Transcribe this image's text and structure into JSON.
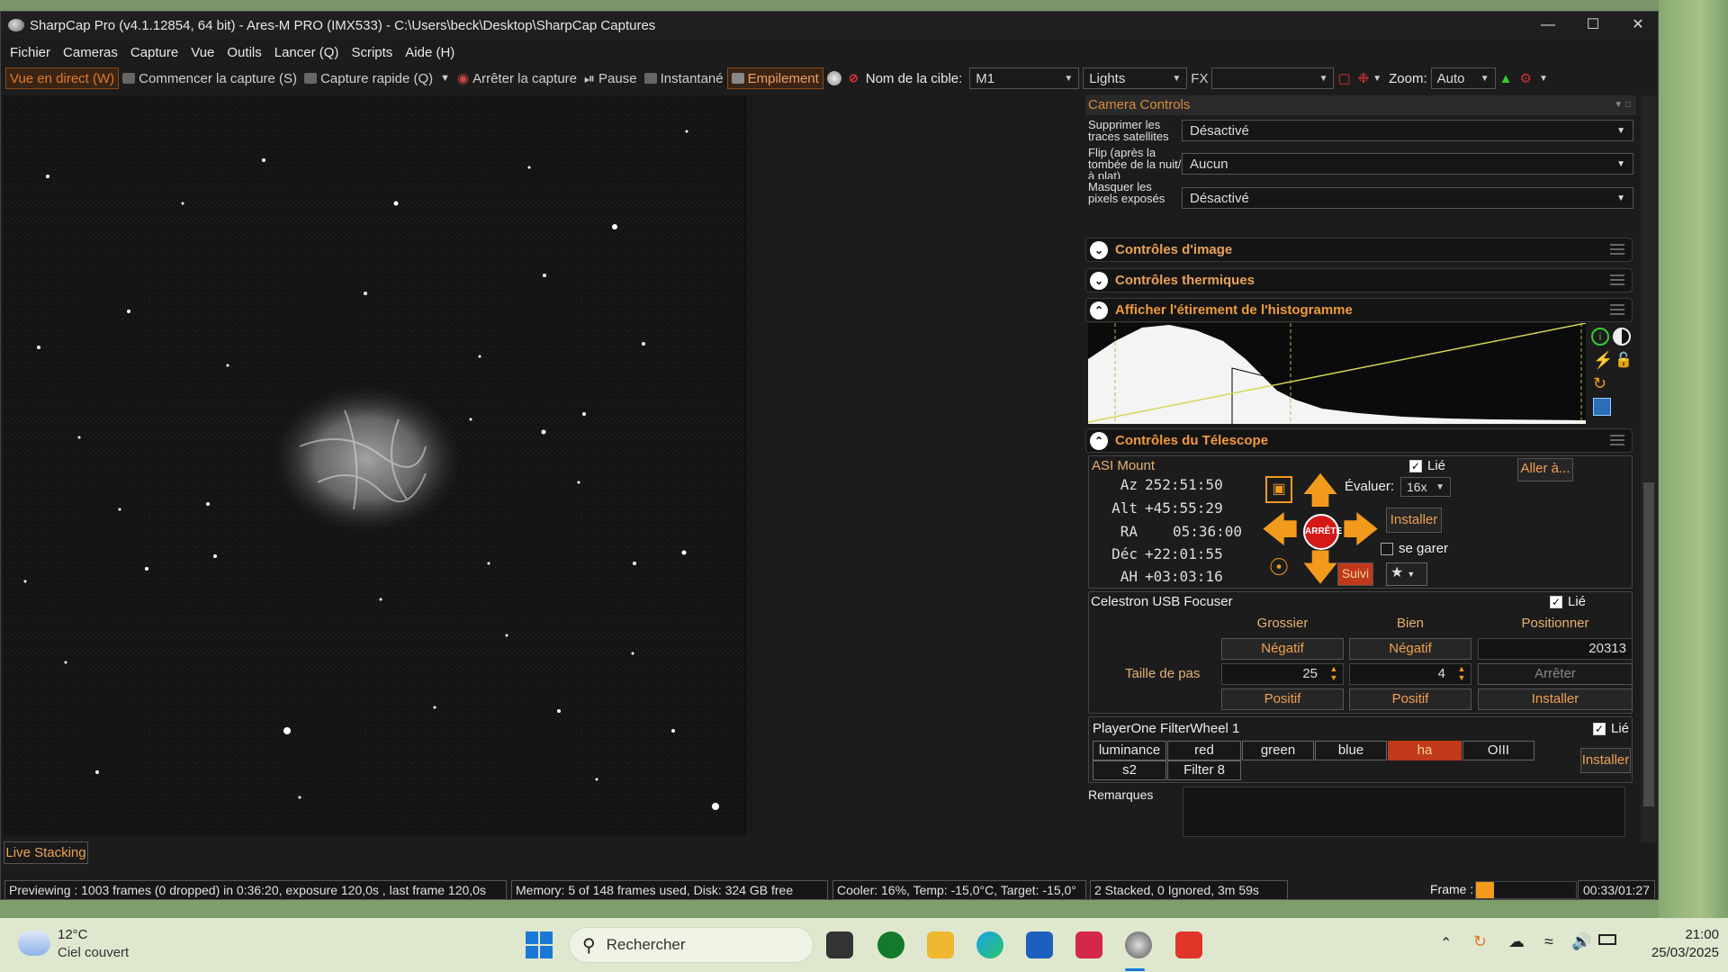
{
  "window": {
    "title": "SharpCap Pro (v4.1.12854, 64 bit) - Ares-M PRO (IMX533) - C:\\Users\\beck\\Desktop\\SharpCap Captures"
  },
  "menu": [
    "Fichier",
    "Cameras",
    "Capture",
    "Vue",
    "Outils",
    "Lancer (Q)",
    "Scripts",
    "Aide (H)"
  ],
  "toolbar": {
    "live_view": "Vue en direct (W)",
    "start_capture": "Commencer la capture (S)",
    "quick_capture": "Capture rapide (Q)",
    "stop_capture": "Arrêter la capture",
    "pause": "Pause",
    "snapshot": "Instantané",
    "stacking": "Empilement",
    "target_label": "Nom de la cible:",
    "target_value": "M1",
    "frame_type": "Lights",
    "fx_label": "FX",
    "zoom_label": "Zoom:",
    "zoom_value": "Auto"
  },
  "camera_controls": {
    "title": "Camera Controls",
    "rows": [
      {
        "label": "Supprimer les traces satellites",
        "value": "Désactivé"
      },
      {
        "label": "Flip (après la tombée de la nuit/à plat)",
        "value": "Aucun"
      },
      {
        "label": "Masquer les pixels exposés",
        "value": "Désactivé"
      }
    ]
  },
  "panels": {
    "image_controls": "Contrôles d'image",
    "thermal_controls": "Contrôles thermiques",
    "histogram": "Afficher l'étirement de l'histogramme",
    "telescope": "Contrôles du Télescope"
  },
  "mount": {
    "name": "ASI Mount",
    "linked_label": "Lié",
    "goto": "Aller à...",
    "coords": [
      {
        "label": "Az",
        "value": "252:51:50"
      },
      {
        "label": "Alt",
        "value": "+45:55:29"
      },
      {
        "label": "RA",
        "value": "05:36:00"
      },
      {
        "label": "Déc",
        "value": "+22:01:55"
      },
      {
        "label": "AH",
        "value": "+03:03:16"
      }
    ],
    "rate_label": "Évaluer:",
    "rate_value": "16x",
    "setup": "Installer",
    "stop": "ARRÊTE",
    "park_label": "se garer",
    "tracking": "Suivi"
  },
  "focuser": {
    "name": "Celestron USB Focuser",
    "linked_label": "Lié",
    "col_coarse": "Grossier",
    "col_fine": "Bien",
    "col_position": "Positionner",
    "negative": "Négatif",
    "positive": "Positif",
    "step_label": "Taille de pas",
    "coarse_step": "25",
    "fine_step": "4",
    "position": "20313",
    "stop": "Arrêter",
    "setup": "Installer"
  },
  "filterwheel": {
    "name": "PlayerOne FilterWheel 1",
    "linked_label": "Lié",
    "filters": [
      "luminance",
      "red",
      "green",
      "blue",
      "ha",
      "OIII",
      "s2",
      "Filter 8"
    ],
    "active": "ha",
    "setup": "Installer"
  },
  "notes_label": "Remarques",
  "bottom_tab": "Live Stacking",
  "status": {
    "preview": "Previewing : 1003 frames (0 dropped) in 0:36:20, exposure 120,0s , last frame 120,0s",
    "memory": "Memory: 5 of 148 frames used, Disk: 324 GB free",
    "cooler": "Cooler: 16%, Temp: -15,0°C, Target: -15,0°",
    "stacked": "2 Stacked, 0 Ignored, 3m 59s",
    "frame_label": "Frame :",
    "frame_progress": 0.18,
    "time": "00:33/01:27"
  },
  "taskbar": {
    "weather_temp": "12°C",
    "weather_desc": "Ciel couvert",
    "search_placeholder": "Rechercher",
    "clock_time": "21:00",
    "clock_date": "25/03/2025"
  },
  "colors": {
    "accent": "#e0822b",
    "active_filter": "#c0391b"
  }
}
